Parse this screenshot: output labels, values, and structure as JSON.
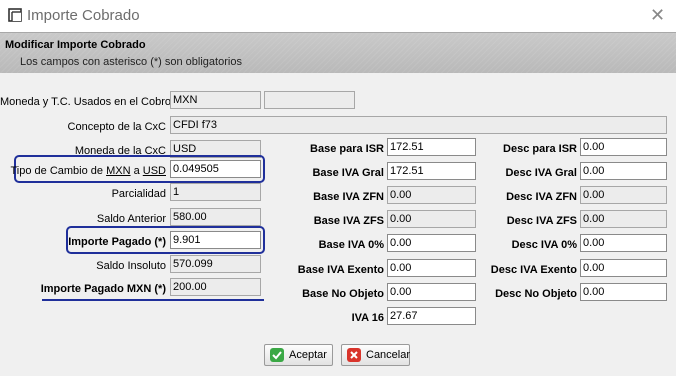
{
  "window": {
    "title": "Importe Cobrado",
    "close_glyph": "✕"
  },
  "header": {
    "title": "Modificar Importe Cobrado",
    "subtitle": "Los campos con asterisco (*) son obligatorios"
  },
  "left": {
    "moneda_tc_label": "Moneda y T.C. Usados en el Cobro",
    "moneda_tc_value": "MXN",
    "moneda_tc_value2": "",
    "concepto_label": "Concepto de la CxC",
    "concepto_value": "CFDI f73",
    "moneda_cxc_label": "Moneda de la CxC",
    "moneda_cxc_value": "USD",
    "tipo_cambio_prefix": "Tipo de Cambio de ",
    "tipo_cambio_from": "MXN",
    "tipo_cambio_mid": " a ",
    "tipo_cambio_to": "USD",
    "tipo_cambio_value": "0.049505",
    "parcialidad_label": "Parcialidad",
    "parcialidad_value": "1",
    "saldo_anterior_label": "Saldo Anterior",
    "saldo_anterior_value": "580.00",
    "importe_pagado_label": "Importe Pagado (*)",
    "importe_pagado_value": "9.901",
    "saldo_insoluto_label": "Saldo Insoluto",
    "saldo_insoluto_value": "570.099",
    "importe_mxn_label": "Importe Pagado MXN (*)",
    "importe_mxn_value": "200.00"
  },
  "middle": [
    {
      "label": "Base para ISR",
      "value": "172.51",
      "editable": true
    },
    {
      "label": "Base IVA Gral",
      "value": "172.51",
      "editable": true
    },
    {
      "label": "Base IVA ZFN",
      "value": "0.00",
      "editable": false
    },
    {
      "label": "Base IVA ZFS",
      "value": "0.00",
      "editable": false
    },
    {
      "label": "Base IVA 0%",
      "value": "0.00",
      "editable": true
    },
    {
      "label": "Base IVA Exento",
      "value": "0.00",
      "editable": true
    },
    {
      "label": "Base No Objeto",
      "value": "0.00",
      "editable": true
    },
    {
      "label": "IVA 16",
      "value": "27.67",
      "editable": true
    }
  ],
  "right": [
    {
      "label": "Desc para ISR",
      "value": "0.00",
      "editable": true
    },
    {
      "label": "Desc IVA Gral",
      "value": "0.00",
      "editable": true
    },
    {
      "label": "Desc IVA ZFN",
      "value": "0.00",
      "editable": false
    },
    {
      "label": "Desc IVA ZFS",
      "value": "0.00",
      "editable": false
    },
    {
      "label": "Desc IVA 0%",
      "value": "0.00",
      "editable": true
    },
    {
      "label": "Desc IVA Exento",
      "value": "0.00",
      "editable": true
    },
    {
      "label": "Desc No Objeto",
      "value": "0.00",
      "editable": true
    }
  ],
  "buttons": {
    "accept": "Aceptar",
    "cancel": "Cancelar"
  },
  "colors": {
    "highlight": "#1f2f9a",
    "accept_icon": "#3aa845",
    "cancel_icon": "#d9342b"
  }
}
